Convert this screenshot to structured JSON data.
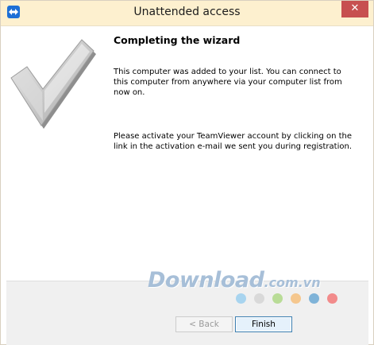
{
  "window": {
    "title": "Unattended access",
    "close_label": "✕"
  },
  "wizard": {
    "heading": "Completing the wizard",
    "paragraph1": "This computer was added to your list. You can connect to this computer from anywhere via your computer list from now on.",
    "paragraph2": "Please activate your TeamViewer account by clicking on the link in the activation e-mail we sent you during registration."
  },
  "watermark": {
    "main": "Download",
    "tld": ".com.vn",
    "dot_colors": [
      "#a8d4ef",
      "#d9d9d9",
      "#b9dc97",
      "#f5c78e",
      "#7fb3d8",
      "#f28b8b"
    ]
  },
  "buttons": {
    "back_label": "< Back",
    "finish_label": "Finish"
  },
  "icons": {
    "app": "teamviewer-icon",
    "checkmark": "checkmark-icon",
    "close": "close-icon"
  }
}
